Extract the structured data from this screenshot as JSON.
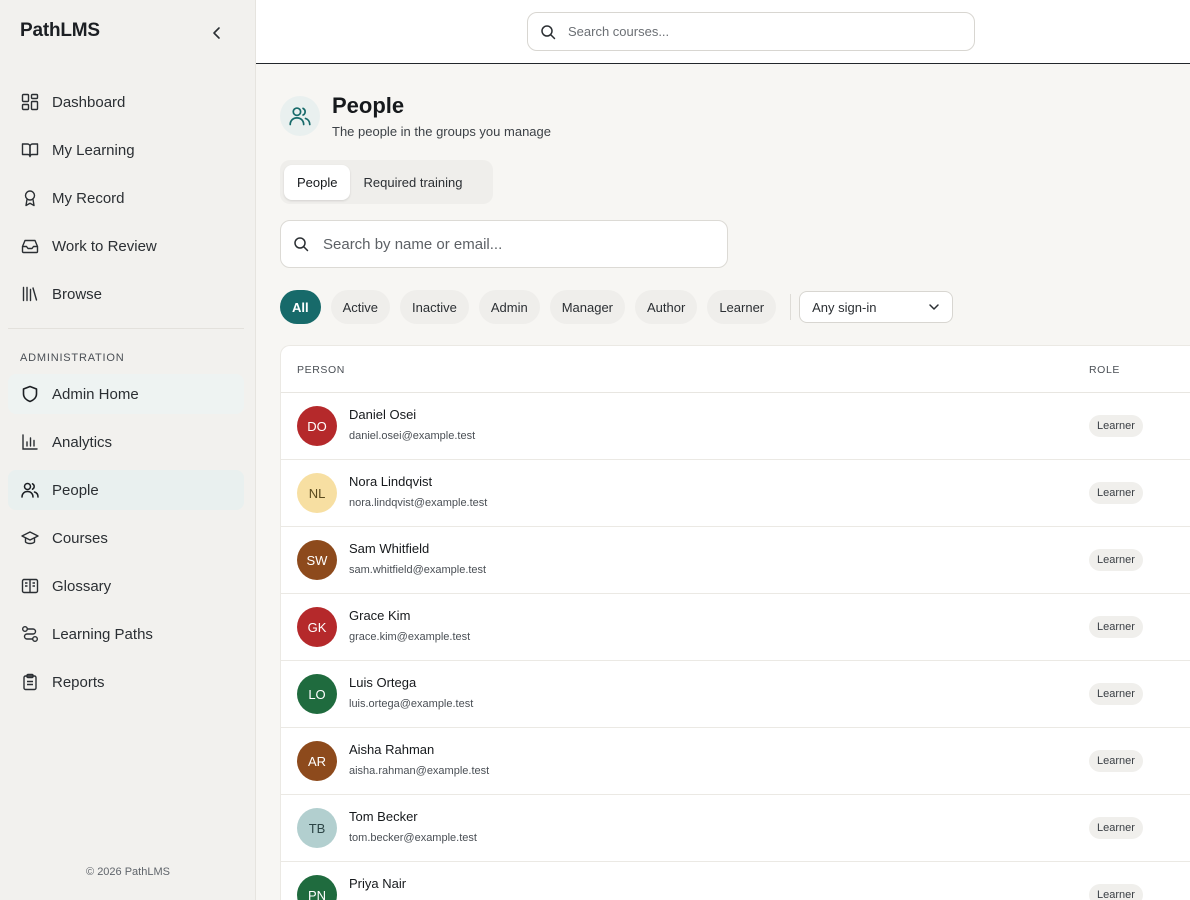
{
  "app": {
    "name": "PathLMS",
    "footer": "© 2026 PathLMS"
  },
  "topbar": {
    "search_placeholder": "Search courses..."
  },
  "sidebar": {
    "items": [
      {
        "label": "Dashboard",
        "icon": "dashboard-icon"
      },
      {
        "label": "My Learning",
        "icon": "book-icon"
      },
      {
        "label": "My Record",
        "icon": "award-icon"
      },
      {
        "label": "Work to Review",
        "icon": "inbox-icon"
      },
      {
        "label": "Browse",
        "icon": "library-icon"
      }
    ],
    "admin_label": "ADMINISTRATION",
    "admin_items": [
      {
        "label": "Admin Home",
        "icon": "shield-icon"
      },
      {
        "label": "Analytics",
        "icon": "bar-chart-icon"
      },
      {
        "label": "People",
        "icon": "users-icon"
      },
      {
        "label": "Courses",
        "icon": "graduation-cap-icon"
      },
      {
        "label": "Glossary",
        "icon": "book-open-icon"
      },
      {
        "label": "Learning Paths",
        "icon": "route-icon"
      },
      {
        "label": "Reports",
        "icon": "clipboard-icon"
      }
    ]
  },
  "page": {
    "title": "People",
    "subtitle": "The people in the groups you manage",
    "tabs": [
      {
        "label": "People"
      },
      {
        "label": "Required training"
      }
    ],
    "search_placeholder": "Search by name or email...",
    "filters": [
      "All",
      "Active",
      "Inactive",
      "Admin",
      "Manager",
      "Author",
      "Learner"
    ],
    "signin_select": "Any sign-in"
  },
  "table": {
    "columns": {
      "person": "PERSON",
      "role": "ROLE"
    },
    "rows": [
      {
        "initials": "DO",
        "name": "Daniel Osei",
        "email": "daniel.osei@example.test",
        "role": "Learner",
        "avatar_bg": "#b5292b",
        "avatar_fg": "#ffffff"
      },
      {
        "initials": "NL",
        "name": "Nora Lindqvist",
        "email": "nora.lindqvist@example.test",
        "role": "Learner",
        "avatar_bg": "#f7dfa2",
        "avatar_fg": "#5a4a1e"
      },
      {
        "initials": "SW",
        "name": "Sam Whitfield",
        "email": "sam.whitfield@example.test",
        "role": "Learner",
        "avatar_bg": "#8d4a1c",
        "avatar_fg": "#ffffff"
      },
      {
        "initials": "GK",
        "name": "Grace Kim",
        "email": "grace.kim@example.test",
        "role": "Learner",
        "avatar_bg": "#b5292b",
        "avatar_fg": "#ffffff"
      },
      {
        "initials": "LO",
        "name": "Luis Ortega",
        "email": "luis.ortega@example.test",
        "role": "Learner",
        "avatar_bg": "#1f6b3e",
        "avatar_fg": "#ffffff"
      },
      {
        "initials": "AR",
        "name": "Aisha Rahman",
        "email": "aisha.rahman@example.test",
        "role": "Learner",
        "avatar_bg": "#8d4a1c",
        "avatar_fg": "#ffffff"
      },
      {
        "initials": "TB",
        "name": "Tom Becker",
        "email": "tom.becker@example.test",
        "role": "Learner",
        "avatar_bg": "#b2cfcf",
        "avatar_fg": "#2c4546"
      },
      {
        "initials": "PN",
        "name": "Priya Nair",
        "email": "",
        "role": "Learner",
        "avatar_bg": "#1f6b3e",
        "avatar_fg": "#ffffff"
      }
    ]
  },
  "colors": {
    "accent": "#176a6a",
    "sidebar_bg": "#f2f1ee",
    "page_bg": "#f7f6f3"
  }
}
